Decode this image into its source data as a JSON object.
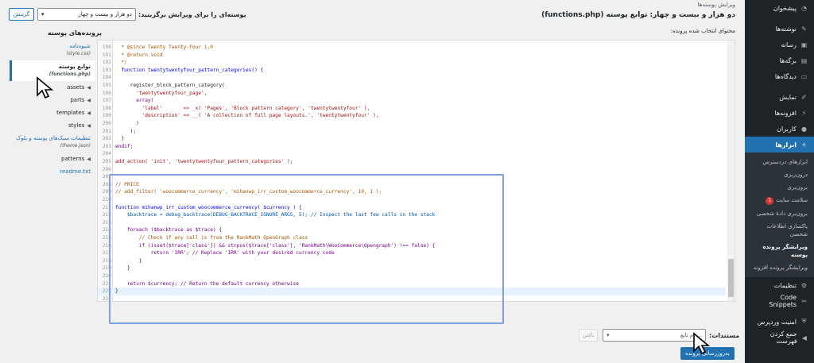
{
  "header": {
    "top_title": "ویرایش پوسته‌ها",
    "file_title": "دو هزار و بیست و چهار: توابع پوسته (functions.php)",
    "choose_label": "پوسته‌ای را برای ویرایش برگزینید:",
    "theme_select_value": "دو هزار و بیست و چهار",
    "choose_button": "گزینش",
    "selected_content_label": "محتوای انتخاب شده پرونده:"
  },
  "files": {
    "title": "پرونده‌های پوسته",
    "items": [
      {
        "label": "شیوه‌نامه",
        "sub": "(style.css)",
        "type": "file"
      },
      {
        "label": "توابع پوسته",
        "sub": "(functions.php)",
        "type": "file",
        "current": true
      },
      {
        "label": "assets",
        "type": "dir"
      },
      {
        "label": "parts",
        "type": "dir"
      },
      {
        "label": "templates",
        "type": "dir"
      },
      {
        "label": "styles",
        "type": "dir"
      },
      {
        "label": "تنظیمات سبک‌های پوسته و بلوک",
        "sub": "(theme.json)",
        "type": "file"
      },
      {
        "label": "patterns",
        "type": "dir"
      },
      {
        "label": "readme.txt",
        "type": "file"
      }
    ]
  },
  "editor": {
    "lines": [
      {
        "n": "190",
        "t": "  * @since Twenty Twenty-Four 1.0",
        "c": "com"
      },
      {
        "n": "191",
        "t": "  * @return void",
        "c": "com"
      },
      {
        "n": "192",
        "t": "  */",
        "c": "com"
      },
      {
        "n": "193",
        "t": "  function twentytwentyfour_pattern_categories() {",
        "c": "fn"
      },
      {
        "n": "194",
        "t": "",
        "c": "def"
      },
      {
        "n": "195",
        "t": "     register_block_pattern_category(",
        "c": "def"
      },
      {
        "n": "196",
        "t": "       'twentytwentyfour_page',",
        "c": "str"
      },
      {
        "n": "197",
        "t": "       array(",
        "c": "kw"
      },
      {
        "n": "198",
        "t": "         'label'       => _x( 'Pages', 'Block pattern category', 'twentytwentyfour' ),",
        "c": "str"
      },
      {
        "n": "199",
        "t": "         'description' => __( 'A collection of full page layouts.', 'twentytwentyfour' ),",
        "c": "str"
      },
      {
        "n": "200",
        "t": "       )",
        "c": "def"
      },
      {
        "n": "201",
        "t": "     );",
        "c": "def"
      },
      {
        "n": "202",
        "t": "  }",
        "c": "def"
      },
      {
        "n": "203",
        "t": "endif;",
        "c": "kw"
      },
      {
        "n": "204",
        "t": "",
        "c": "def"
      },
      {
        "n": "205",
        "t": "add_action( 'init', 'twentytwentyfour_pattern_categories' );",
        "c": "str"
      },
      {
        "n": "206",
        "t": "",
        "c": "def"
      },
      {
        "n": "207",
        "t": "",
        "c": "def"
      },
      {
        "n": "208",
        "t": "// PRICE",
        "c": "com"
      },
      {
        "n": "209",
        "t": "// add_filter( 'woocommerce_currency', 'mihanwp_irr_custom_woocommerce_currency', 10, 1 );",
        "c": "com"
      },
      {
        "n": "210",
        "t": "",
        "c": "def"
      },
      {
        "n": "211",
        "t": "function mihanwp_irr_custom_woocommerce_currency( $currency ) {",
        "c": "fn"
      },
      {
        "n": "212",
        "t": "    $backtrace = debug_backtrace(DEBUG_BACKTRACE_IGNORE_ARGS, 5); // Inspect the last few calls in the stack",
        "c": "var"
      },
      {
        "n": "213",
        "t": "",
        "c": "def"
      },
      {
        "n": "214",
        "t": "    foreach ($backtrace as $trace) {",
        "c": "kw"
      },
      {
        "n": "215",
        "t": "        // Check if any call is from the RankMath OpenGraph class",
        "c": "com"
      },
      {
        "n": "216",
        "t": "        if (isset($trace['class']) && strpos($trace['class'], 'RankMath\\WooCommerce\\Opengraph') !== false) {",
        "c": "kw"
      },
      {
        "n": "217",
        "t": "            return 'IRR'; // Replace 'IRR' with your desired currency code",
        "c": "kw"
      },
      {
        "n": "218",
        "t": "        }",
        "c": "def"
      },
      {
        "n": "219",
        "t": "    }",
        "c": "def"
      },
      {
        "n": "220",
        "t": "",
        "c": "def"
      },
      {
        "n": "221",
        "t": "    return $currency; // Return the default currency otherwise",
        "c": "kw"
      },
      {
        "n": "222",
        "t": "}",
        "c": "def"
      },
      {
        "n": "223",
        "t": "",
        "c": "def"
      }
    ]
  },
  "bottom": {
    "doc_label": "مستندات:",
    "doc_select_placeholder": "...نام تابع",
    "lookup_button": "یافتن",
    "update_button": "به‌روزرسانی پرونده"
  },
  "sidebar": {
    "items": [
      {
        "label": "پیشخوان",
        "icon": "dashboard-icon",
        "glyph": "◔"
      },
      {
        "sep": true
      },
      {
        "label": "نوشته‌ها",
        "icon": "pin-icon",
        "glyph": "✎"
      },
      {
        "label": "رسانه",
        "icon": "media-icon",
        "glyph": "▣"
      },
      {
        "label": "برگه‌ها",
        "icon": "pages-icon",
        "glyph": "▤"
      },
      {
        "label": "دیدگاه‌ها",
        "icon": "comments-icon",
        "glyph": "▭"
      },
      {
        "sep": true
      },
      {
        "label": "نمایش",
        "icon": "appearance-icon",
        "glyph": "✐"
      },
      {
        "label": "افزونه‌ها",
        "icon": "plugins-icon",
        "glyph": "⚡"
      },
      {
        "label": "کاربران",
        "icon": "users-icon",
        "glyph": "●"
      },
      {
        "label": "ابزارها",
        "icon": "tools-icon",
        "glyph": "✧",
        "active": true
      }
    ],
    "submenu": [
      {
        "label": "ابزارهای دردسترس"
      },
      {
        "label": "درون‌ریزی"
      },
      {
        "label": "برون‌بری"
      },
      {
        "label": "سلامت سایت",
        "badge": "1"
      },
      {
        "label": "برون‌بری دادهٔ شخصی"
      },
      {
        "label": "پاکسازی اطلاعات شخصی"
      },
      {
        "label": "ویرایشگر پرونده پوسته",
        "current": true
      },
      {
        "label": "ویرایشگر پرونده افزونه"
      }
    ],
    "items_after": [
      {
        "label": "تنظیمات",
        "icon": "settings-icon",
        "glyph": "⚙"
      },
      {
        "label": "Code Snippets",
        "icon": "code-snippets-icon",
        "glyph": "✂"
      },
      {
        "sep": true
      },
      {
        "label": "امنیت وردپرس",
        "icon": "security-shield-icon",
        "glyph": "⛨"
      },
      {
        "label": "جمع کردن فهرست",
        "icon": "collapse-icon",
        "glyph": "◀"
      }
    ]
  }
}
